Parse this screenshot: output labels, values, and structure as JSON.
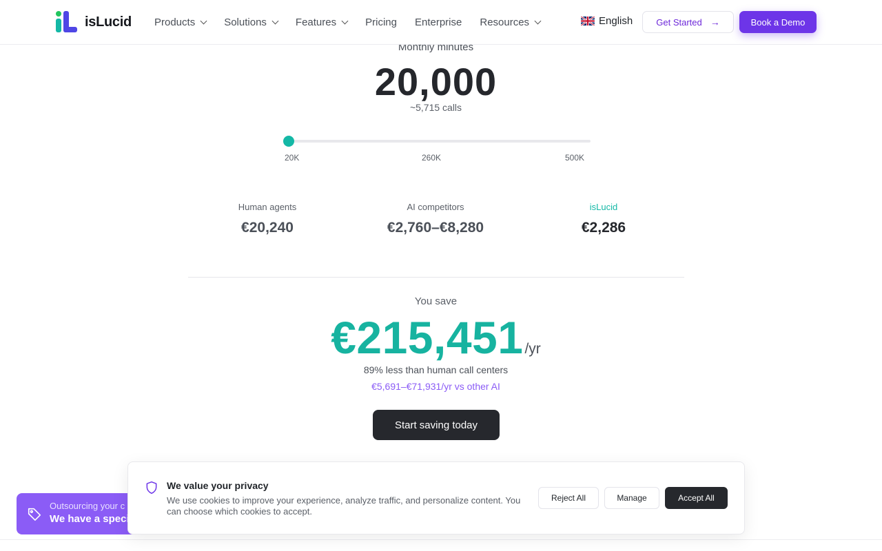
{
  "brand": {
    "name": "isLucid"
  },
  "nav": {
    "items": [
      {
        "label": "Products",
        "has_menu": true
      },
      {
        "label": "Solutions",
        "has_menu": true
      },
      {
        "label": "Features",
        "has_menu": true
      },
      {
        "label": "Pricing",
        "has_menu": false
      },
      {
        "label": "Enterprise",
        "has_menu": false
      },
      {
        "label": "Resources",
        "has_menu": true
      }
    ],
    "language": "English",
    "language_flag_icon": "uk-flag-icon",
    "get_started": "Get Started",
    "book_demo": "Book a Demo"
  },
  "calculator": {
    "monthly_label": "Monthly minutes",
    "minutes": "20,000",
    "calls": "~5,715 calls",
    "slider": {
      "min_label": "20K",
      "mid_label": "260K",
      "max_label": "500K",
      "level": 0.0
    },
    "compare": [
      {
        "label": "Human agents",
        "value": "€20,240"
      },
      {
        "label": "AI competitors",
        "value": "€2,760–€8,280"
      },
      {
        "label": "isLucid",
        "value": "€2,286"
      }
    ],
    "save_label": "You save",
    "savings_amount": "€215,451",
    "savings_period": "/yr",
    "less_than": "89% less than human call centers",
    "vs_ai": "€5,691–€71,931/yr vs other AI",
    "cta": "Start saving today"
  },
  "promo": {
    "line1": "Outsourcing your c",
    "line2": "We have a speci",
    "icon": "tag-icon"
  },
  "cookie": {
    "title": "We value your privacy",
    "text": "We use cookies to improve your experience, analyze traffic, and personalize content. You can choose which cookies to accept.",
    "reject": "Reject All",
    "manage": "Manage",
    "accept": "Accept All",
    "icon": "shield-icon"
  },
  "colors": {
    "accent_teal": "#14b8a6",
    "accent_purple": "#6d35e8",
    "dark_button": "#26282d"
  }
}
